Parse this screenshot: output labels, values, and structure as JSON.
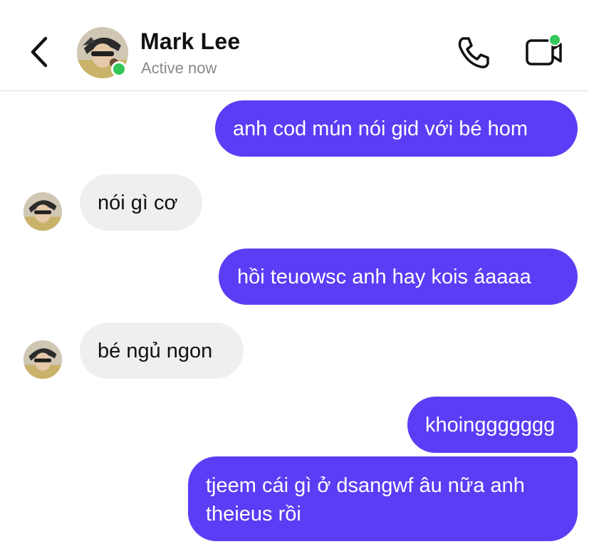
{
  "header": {
    "back_icon": "chevron-left-icon",
    "contact_name": "Mark Lee",
    "status": "Active now",
    "presence_color": "#35c759",
    "call_icon": "phone-icon",
    "video_icon": "video-camera-icon"
  },
  "colors": {
    "outgoing_bubble": "#5b3df5",
    "incoming_bubble": "#efefef"
  },
  "messages": [
    {
      "direction": "outgoing",
      "text": "anh cod mún nói gid với bé hom"
    },
    {
      "direction": "incoming",
      "text": "nói gì cơ"
    },
    {
      "direction": "outgoing",
      "text": "hồi teuowsc anh hay kois áaaaa"
    },
    {
      "direction": "incoming",
      "text": "bé ngủ ngon"
    },
    {
      "direction": "outgoing",
      "text": "khoinggggggg"
    },
    {
      "direction": "outgoing",
      "text_line1": "tjeem cái gì ở dsangwf âu nữa anh",
      "text_line2": "theieus rồi"
    }
  ]
}
